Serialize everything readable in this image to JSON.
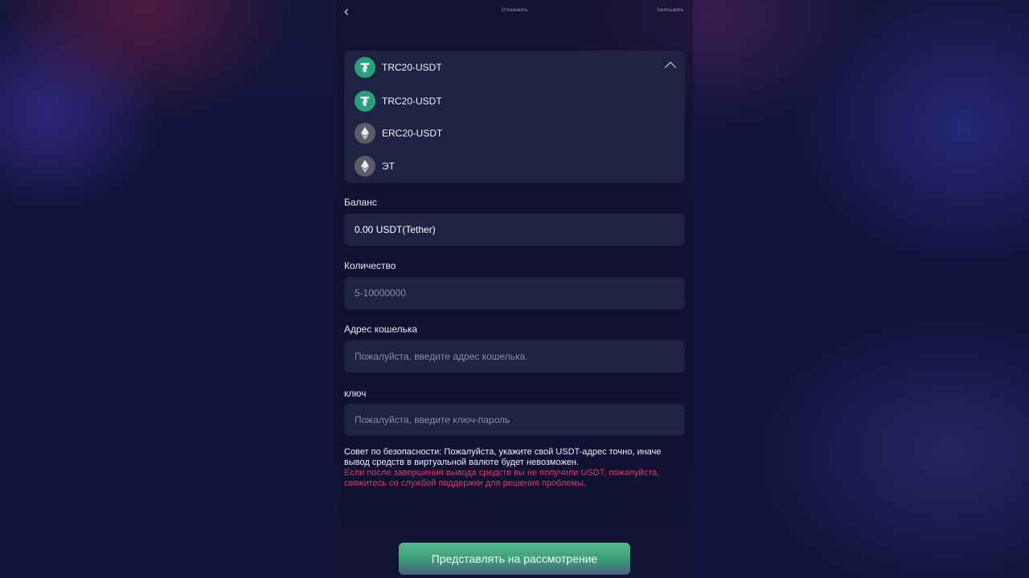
{
  "header": {
    "back_icon": "chevron-left-icon",
    "center_text": "Отказывать",
    "right_text": "Записывать"
  },
  "network_dropdown": {
    "selected": {
      "label": "TRC20-USDT",
      "icon": "tether-icon"
    },
    "options": [
      {
        "label": "TRC20-USDT",
        "icon": "tether-icon"
      },
      {
        "label": "ERC20-USDT",
        "icon": "ethereum-icon"
      },
      {
        "label": "ЭТ",
        "icon": "ethereum-icon"
      }
    ],
    "toggle_icon": "chevron-up-icon"
  },
  "balance": {
    "label": "Баланс",
    "value": "0.00 USDT(Tether)"
  },
  "quantity": {
    "label": "Количество",
    "placeholder": "5-10000000",
    "value": ""
  },
  "wallet_address": {
    "label": "Адрес кошелька",
    "placeholder": "Пожалуйста, введите адрес кошелька.",
    "value": ""
  },
  "key": {
    "label": "ключ",
    "placeholder": "Пожалуйста, введите ключ-пароль",
    "value": ""
  },
  "notice": {
    "security_tip": "Совет по безопасности: Пожалуйста, укажите свой USDT-адрес точно, иначе вывод средств в виртуальной валюте будет невозможен.",
    "warning": "Если после завершения вывода средств вы не получили USDT, пожалуйста, свяжитесь со службой поддержки для решения проблемы."
  },
  "submit": {
    "label": "Представлять на рассмотрение"
  },
  "colors": {
    "tether": "#26a17b",
    "warning_red": "#e0365e",
    "button_green": "#4aa882",
    "field_bg": "#202244"
  }
}
